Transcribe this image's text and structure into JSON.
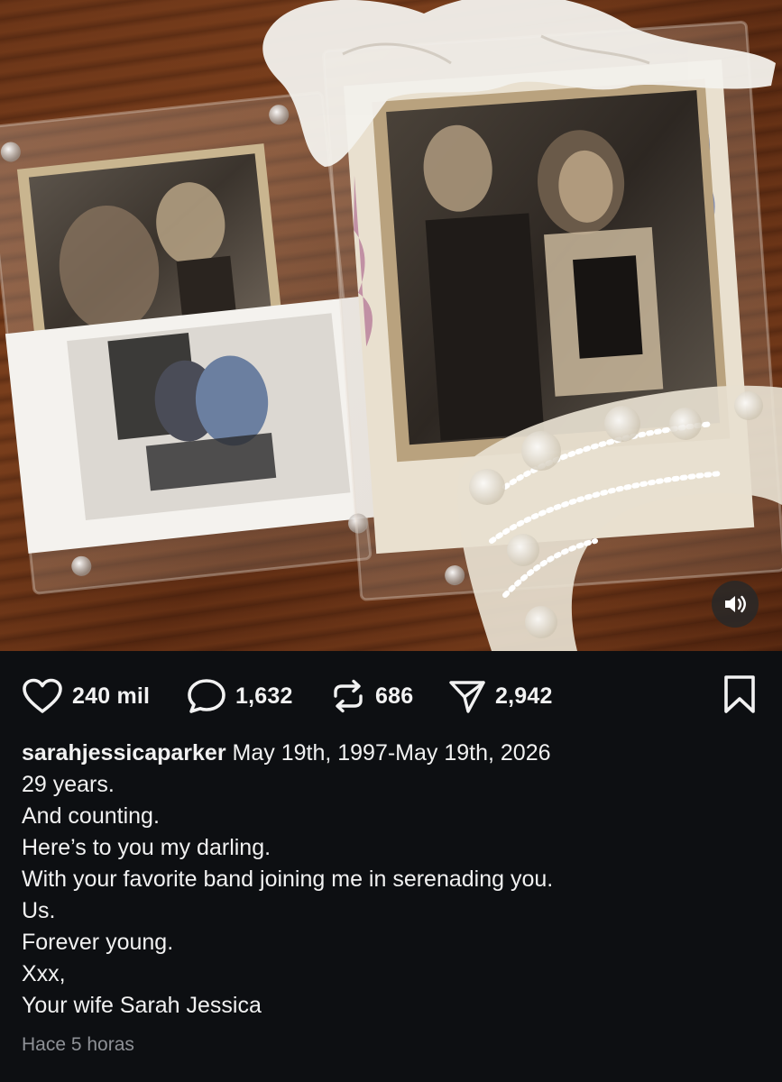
{
  "post": {
    "actions": {
      "likes": "240 mil",
      "comments": "1,632",
      "reposts": "686",
      "shares": "2,942"
    },
    "caption": {
      "username": "sarahjessicaparker",
      "first_line": "May 19th, 1997-May 19th, 2026",
      "lines": [
        "29 years.",
        "And counting.",
        "Here’s to you my darling.",
        "With your favorite band joining me in serenading you.",
        "Us.",
        "Forever young.",
        "Xxx,",
        "Your wife Sarah Jessica"
      ]
    },
    "timestamp": "Hace 5 horas"
  },
  "icons": {
    "like": "heart-icon",
    "comment": "comment-bubble-icon",
    "repost": "repost-icon",
    "share": "send-icon",
    "save": "bookmark-icon",
    "audio": "speaker-icon"
  },
  "colors": {
    "background": "#0d0f12",
    "text": "#f1f1f1",
    "muted": "#8e9196"
  }
}
